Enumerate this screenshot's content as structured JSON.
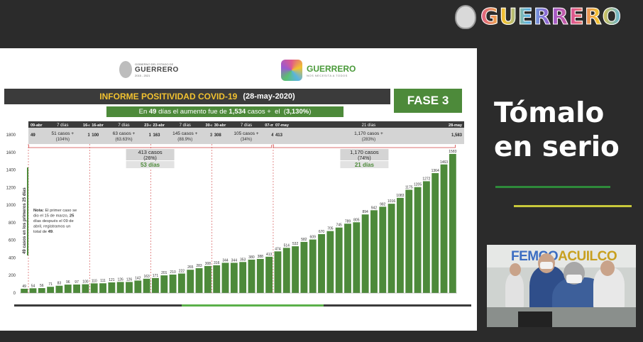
{
  "brand": {
    "name": "GUERRERO",
    "seal_icon": "state-seal-icon"
  },
  "slide": {
    "gov_logo": {
      "small_text": "GOBIERNO DEL ESTADO DE",
      "name": "GUERRERO",
      "years": "2015 - 2021"
    },
    "gro_logo": {
      "name": "GUERRERO",
      "tagline": "NOS NECESITA A TODOS"
    },
    "title": "INFORME POSITIVIDAD COVID-19",
    "date": "(28-may-2020)",
    "fase": "FASE 3",
    "summary_parts": [
      "En ",
      "49",
      " días el aumento fue de ",
      "1,534",
      " casos +  el  (",
      "3,130%",
      ")"
    ]
  },
  "right_panel": {
    "tagline_line1": "Tómalo",
    "tagline_line2": "en serio",
    "video_banner_a": "FEMCO",
    "video_banner_b": "ACUILCO",
    "colors": {
      "green": "#2e8a3a",
      "yellow": "#c8c83a"
    }
  },
  "chart_data": {
    "type": "bar",
    "bar_color": "#4d8a3a",
    "ylim": [
      0,
      1800
    ],
    "yticks": [
      0,
      200,
      400,
      600,
      800,
      1000,
      1200,
      1400,
      1600,
      1800
    ],
    "values": [
      49,
      54,
      56,
      71,
      83,
      96,
      97,
      100,
      110,
      111,
      121,
      126,
      126,
      142,
      163,
      171,
      201,
      210,
      222,
      265,
      283,
      308,
      316,
      344,
      344,
      353,
      380,
      388,
      413,
      474,
      514,
      532,
      582,
      609,
      670,
      705,
      745,
      789,
      805,
      894,
      942,
      982,
      1016,
      1083,
      1175,
      1205,
      1272,
      1364,
      1463,
      1583
    ],
    "y_annotation": "49 casos en los primeros 25 días",
    "note": {
      "parts": [
        "Nota: ",
        "El primer caso se dio el 15 de marzo, ",
        "25",
        " días después el 09 de abril, registramos un total de ",
        "49",
        "."
      ]
    },
    "periods": [
      {
        "start_label": "09-abr",
        "days": "7 días",
        "end_label": "16-abr",
        "start_val": "49",
        "cases": "51 casos +",
        "pct": "(104%)",
        "end_val": "100"
      },
      {
        "start_label": "16-abr",
        "days": "7 días",
        "end_label": "23-abr",
        "start_val": "100",
        "cases": "63 casos +",
        "pct": "(63.63%)",
        "end_val": "163"
      },
      {
        "start_label": "23-abr",
        "days": "7 días",
        "end_label": "30-abr",
        "start_val": "163",
        "cases": "145 casos +",
        "pct": "(88.9%)",
        "end_val": "308"
      },
      {
        "start_label": "30-abr",
        "days": "7 días",
        "end_label": "07-may",
        "start_val": "308",
        "cases": "105 casos +",
        "pct": "(34%)",
        "end_val": "413"
      },
      {
        "start_label": "07-may",
        "days": "21 días",
        "end_label": "28-may",
        "start_val": "413",
        "cases": "1,170 casos +",
        "pct": "(283%)",
        "end_val": "1,583"
      }
    ],
    "brackets": [
      {
        "cases": "413 casos",
        "pct": "(26%)",
        "days": "53 días"
      },
      {
        "cases": "1,170 casos",
        "pct": "(74%)",
        "days": "21 días"
      }
    ],
    "axis_footer_colors": [
      "#3b3b3b",
      "#5ab04a",
      "#3b3b3b"
    ]
  }
}
